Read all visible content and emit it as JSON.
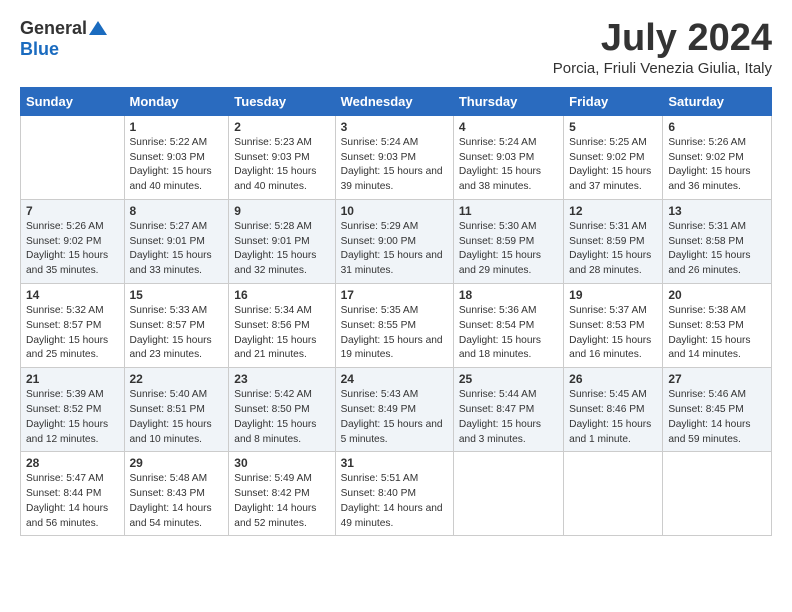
{
  "header": {
    "logo_general": "General",
    "logo_blue": "Blue",
    "title": "July 2024",
    "subtitle": "Porcia, Friuli Venezia Giulia, Italy"
  },
  "days": [
    "Sunday",
    "Monday",
    "Tuesday",
    "Wednesday",
    "Thursday",
    "Friday",
    "Saturday"
  ],
  "weeks": [
    [
      {
        "date": "",
        "sunrise": "",
        "sunset": "",
        "daylight": ""
      },
      {
        "date": "1",
        "sunrise": "Sunrise: 5:22 AM",
        "sunset": "Sunset: 9:03 PM",
        "daylight": "Daylight: 15 hours and 40 minutes."
      },
      {
        "date": "2",
        "sunrise": "Sunrise: 5:23 AM",
        "sunset": "Sunset: 9:03 PM",
        "daylight": "Daylight: 15 hours and 40 minutes."
      },
      {
        "date": "3",
        "sunrise": "Sunrise: 5:24 AM",
        "sunset": "Sunset: 9:03 PM",
        "daylight": "Daylight: 15 hours and 39 minutes."
      },
      {
        "date": "4",
        "sunrise": "Sunrise: 5:24 AM",
        "sunset": "Sunset: 9:03 PM",
        "daylight": "Daylight: 15 hours and 38 minutes."
      },
      {
        "date": "5",
        "sunrise": "Sunrise: 5:25 AM",
        "sunset": "Sunset: 9:02 PM",
        "daylight": "Daylight: 15 hours and 37 minutes."
      },
      {
        "date": "6",
        "sunrise": "Sunrise: 5:26 AM",
        "sunset": "Sunset: 9:02 PM",
        "daylight": "Daylight: 15 hours and 36 minutes."
      }
    ],
    [
      {
        "date": "7",
        "sunrise": "Sunrise: 5:26 AM",
        "sunset": "Sunset: 9:02 PM",
        "daylight": "Daylight: 15 hours and 35 minutes."
      },
      {
        "date": "8",
        "sunrise": "Sunrise: 5:27 AM",
        "sunset": "Sunset: 9:01 PM",
        "daylight": "Daylight: 15 hours and 33 minutes."
      },
      {
        "date": "9",
        "sunrise": "Sunrise: 5:28 AM",
        "sunset": "Sunset: 9:01 PM",
        "daylight": "Daylight: 15 hours and 32 minutes."
      },
      {
        "date": "10",
        "sunrise": "Sunrise: 5:29 AM",
        "sunset": "Sunset: 9:00 PM",
        "daylight": "Daylight: 15 hours and 31 minutes."
      },
      {
        "date": "11",
        "sunrise": "Sunrise: 5:30 AM",
        "sunset": "Sunset: 8:59 PM",
        "daylight": "Daylight: 15 hours and 29 minutes."
      },
      {
        "date": "12",
        "sunrise": "Sunrise: 5:31 AM",
        "sunset": "Sunset: 8:59 PM",
        "daylight": "Daylight: 15 hours and 28 minutes."
      },
      {
        "date": "13",
        "sunrise": "Sunrise: 5:31 AM",
        "sunset": "Sunset: 8:58 PM",
        "daylight": "Daylight: 15 hours and 26 minutes."
      }
    ],
    [
      {
        "date": "14",
        "sunrise": "Sunrise: 5:32 AM",
        "sunset": "Sunset: 8:57 PM",
        "daylight": "Daylight: 15 hours and 25 minutes."
      },
      {
        "date": "15",
        "sunrise": "Sunrise: 5:33 AM",
        "sunset": "Sunset: 8:57 PM",
        "daylight": "Daylight: 15 hours and 23 minutes."
      },
      {
        "date": "16",
        "sunrise": "Sunrise: 5:34 AM",
        "sunset": "Sunset: 8:56 PM",
        "daylight": "Daylight: 15 hours and 21 minutes."
      },
      {
        "date": "17",
        "sunrise": "Sunrise: 5:35 AM",
        "sunset": "Sunset: 8:55 PM",
        "daylight": "Daylight: 15 hours and 19 minutes."
      },
      {
        "date": "18",
        "sunrise": "Sunrise: 5:36 AM",
        "sunset": "Sunset: 8:54 PM",
        "daylight": "Daylight: 15 hours and 18 minutes."
      },
      {
        "date": "19",
        "sunrise": "Sunrise: 5:37 AM",
        "sunset": "Sunset: 8:53 PM",
        "daylight": "Daylight: 15 hours and 16 minutes."
      },
      {
        "date": "20",
        "sunrise": "Sunrise: 5:38 AM",
        "sunset": "Sunset: 8:53 PM",
        "daylight": "Daylight: 15 hours and 14 minutes."
      }
    ],
    [
      {
        "date": "21",
        "sunrise": "Sunrise: 5:39 AM",
        "sunset": "Sunset: 8:52 PM",
        "daylight": "Daylight: 15 hours and 12 minutes."
      },
      {
        "date": "22",
        "sunrise": "Sunrise: 5:40 AM",
        "sunset": "Sunset: 8:51 PM",
        "daylight": "Daylight: 15 hours and 10 minutes."
      },
      {
        "date": "23",
        "sunrise": "Sunrise: 5:42 AM",
        "sunset": "Sunset: 8:50 PM",
        "daylight": "Daylight: 15 hours and 8 minutes."
      },
      {
        "date": "24",
        "sunrise": "Sunrise: 5:43 AM",
        "sunset": "Sunset: 8:49 PM",
        "daylight": "Daylight: 15 hours and 5 minutes."
      },
      {
        "date": "25",
        "sunrise": "Sunrise: 5:44 AM",
        "sunset": "Sunset: 8:47 PM",
        "daylight": "Daylight: 15 hours and 3 minutes."
      },
      {
        "date": "26",
        "sunrise": "Sunrise: 5:45 AM",
        "sunset": "Sunset: 8:46 PM",
        "daylight": "Daylight: 15 hours and 1 minute."
      },
      {
        "date": "27",
        "sunrise": "Sunrise: 5:46 AM",
        "sunset": "Sunset: 8:45 PM",
        "daylight": "Daylight: 14 hours and 59 minutes."
      }
    ],
    [
      {
        "date": "28",
        "sunrise": "Sunrise: 5:47 AM",
        "sunset": "Sunset: 8:44 PM",
        "daylight": "Daylight: 14 hours and 56 minutes."
      },
      {
        "date": "29",
        "sunrise": "Sunrise: 5:48 AM",
        "sunset": "Sunset: 8:43 PM",
        "daylight": "Daylight: 14 hours and 54 minutes."
      },
      {
        "date": "30",
        "sunrise": "Sunrise: 5:49 AM",
        "sunset": "Sunset: 8:42 PM",
        "daylight": "Daylight: 14 hours and 52 minutes."
      },
      {
        "date": "31",
        "sunrise": "Sunrise: 5:51 AM",
        "sunset": "Sunset: 8:40 PM",
        "daylight": "Daylight: 14 hours and 49 minutes."
      },
      {
        "date": "",
        "sunrise": "",
        "sunset": "",
        "daylight": ""
      },
      {
        "date": "",
        "sunrise": "",
        "sunset": "",
        "daylight": ""
      },
      {
        "date": "",
        "sunrise": "",
        "sunset": "",
        "daylight": ""
      }
    ]
  ]
}
